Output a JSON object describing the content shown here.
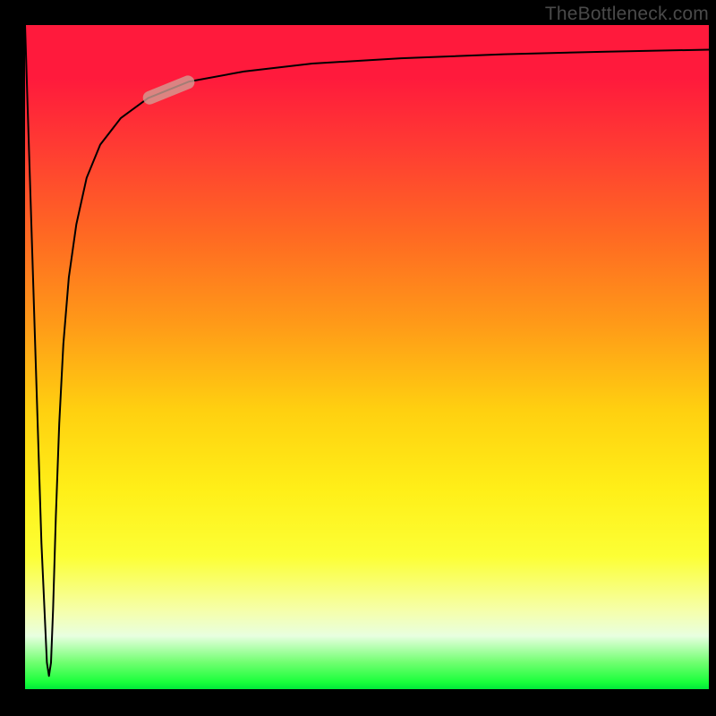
{
  "watermark": "TheBottleneck.com",
  "chart_data": {
    "type": "line",
    "title": "",
    "xlabel": "",
    "ylabel": "",
    "xlim": [
      0,
      100
    ],
    "ylim": [
      0,
      100
    ],
    "series": [
      {
        "name": "bottleneck-curve",
        "x": [
          0.0,
          0.8,
          1.6,
          2.4,
          3.2,
          3.5,
          3.8,
          4.1,
          4.5,
          5.0,
          5.6,
          6.4,
          7.5,
          9.0,
          11.0,
          14.0,
          18.0,
          24.0,
          32.0,
          42.0,
          55.0,
          70.0,
          85.0,
          100.0
        ],
        "y": [
          100.0,
          74.0,
          48.0,
          22.0,
          4.0,
          2.0,
          4.0,
          12.0,
          26.0,
          40.0,
          52.0,
          62.0,
          70.0,
          77.0,
          82.0,
          86.0,
          89.0,
          91.5,
          93.0,
          94.2,
          95.0,
          95.6,
          96.0,
          96.3
        ]
      }
    ],
    "highlight_segment": {
      "x_start": 18.0,
      "x_end": 24.0,
      "y_start": 89.0,
      "y_end": 91.5
    },
    "background_gradient": {
      "top": "#ff1a3c",
      "mid": "#ffd010",
      "bottom": "#00e83a"
    }
  }
}
